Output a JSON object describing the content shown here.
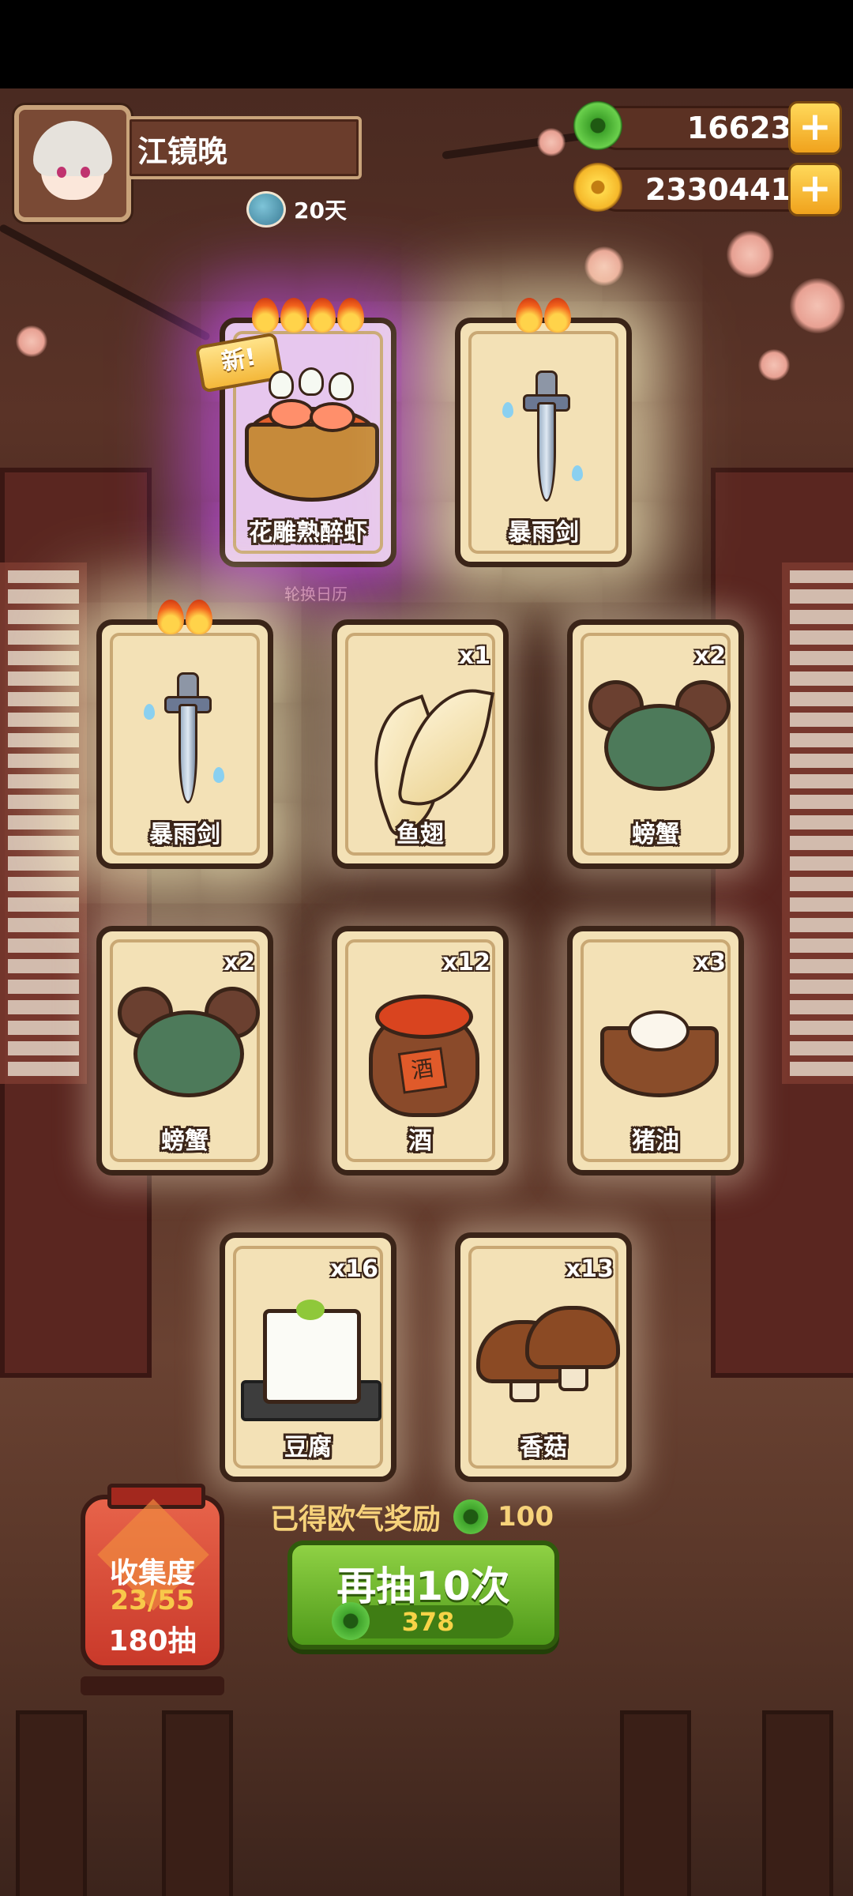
{
  "player": {
    "name": "江镜晚",
    "days": "20天"
  },
  "currencies": [
    {
      "type": "jade",
      "value": "16623"
    },
    {
      "type": "coin",
      "value": "2330441"
    }
  ],
  "calendar_label": "轮换日历",
  "new_tag": "新!",
  "cards": [
    {
      "name": "花雕熟醉虾",
      "count": "",
      "flames": 4,
      "glow": "purple",
      "is_new": true,
      "icon": "shrimp-dish-icon"
    },
    {
      "name": "暴雨剑",
      "count": "",
      "flames": 2,
      "glow": "yellow",
      "is_new": false,
      "icon": "sword-icon"
    },
    {
      "name": "暴雨剑",
      "count": "",
      "flames": 2,
      "glow": "yellow",
      "is_new": false,
      "icon": "sword-icon"
    },
    {
      "name": "鱼翅",
      "count": "x1",
      "flames": 0,
      "glow": "white",
      "is_new": false,
      "icon": "shark-fin-icon"
    },
    {
      "name": "螃蟹",
      "count": "x2",
      "flames": 0,
      "glow": "white",
      "is_new": false,
      "icon": "crab-icon"
    },
    {
      "name": "螃蟹",
      "count": "x2",
      "flames": 0,
      "glow": "white",
      "is_new": false,
      "icon": "crab-icon"
    },
    {
      "name": "酒",
      "count": "x12",
      "flames": 0,
      "glow": "white",
      "is_new": false,
      "icon": "wine-jar-icon"
    },
    {
      "name": "猪油",
      "count": "x3",
      "flames": 0,
      "glow": "white",
      "is_new": false,
      "icon": "lard-bowl-icon"
    },
    {
      "name": "豆腐",
      "count": "x16",
      "flames": 0,
      "glow": "white",
      "is_new": false,
      "icon": "tofu-icon"
    },
    {
      "name": "香菇",
      "count": "x13",
      "flames": 0,
      "glow": "white",
      "is_new": false,
      "icon": "mushroom-icon"
    }
  ],
  "jar_text": "酒",
  "luck_reward": {
    "label": "已得欧气奖励",
    "value": "100"
  },
  "draw_button": {
    "label": "再抽10次",
    "cost": "378"
  },
  "collection": {
    "title": "收集度",
    "progress": "23/55",
    "draws": "180抽"
  },
  "colors": {
    "jade": "#4fb332",
    "coin": "#f5b82a",
    "draw_button": "#6cb82e",
    "lantern": "#d84a35"
  }
}
